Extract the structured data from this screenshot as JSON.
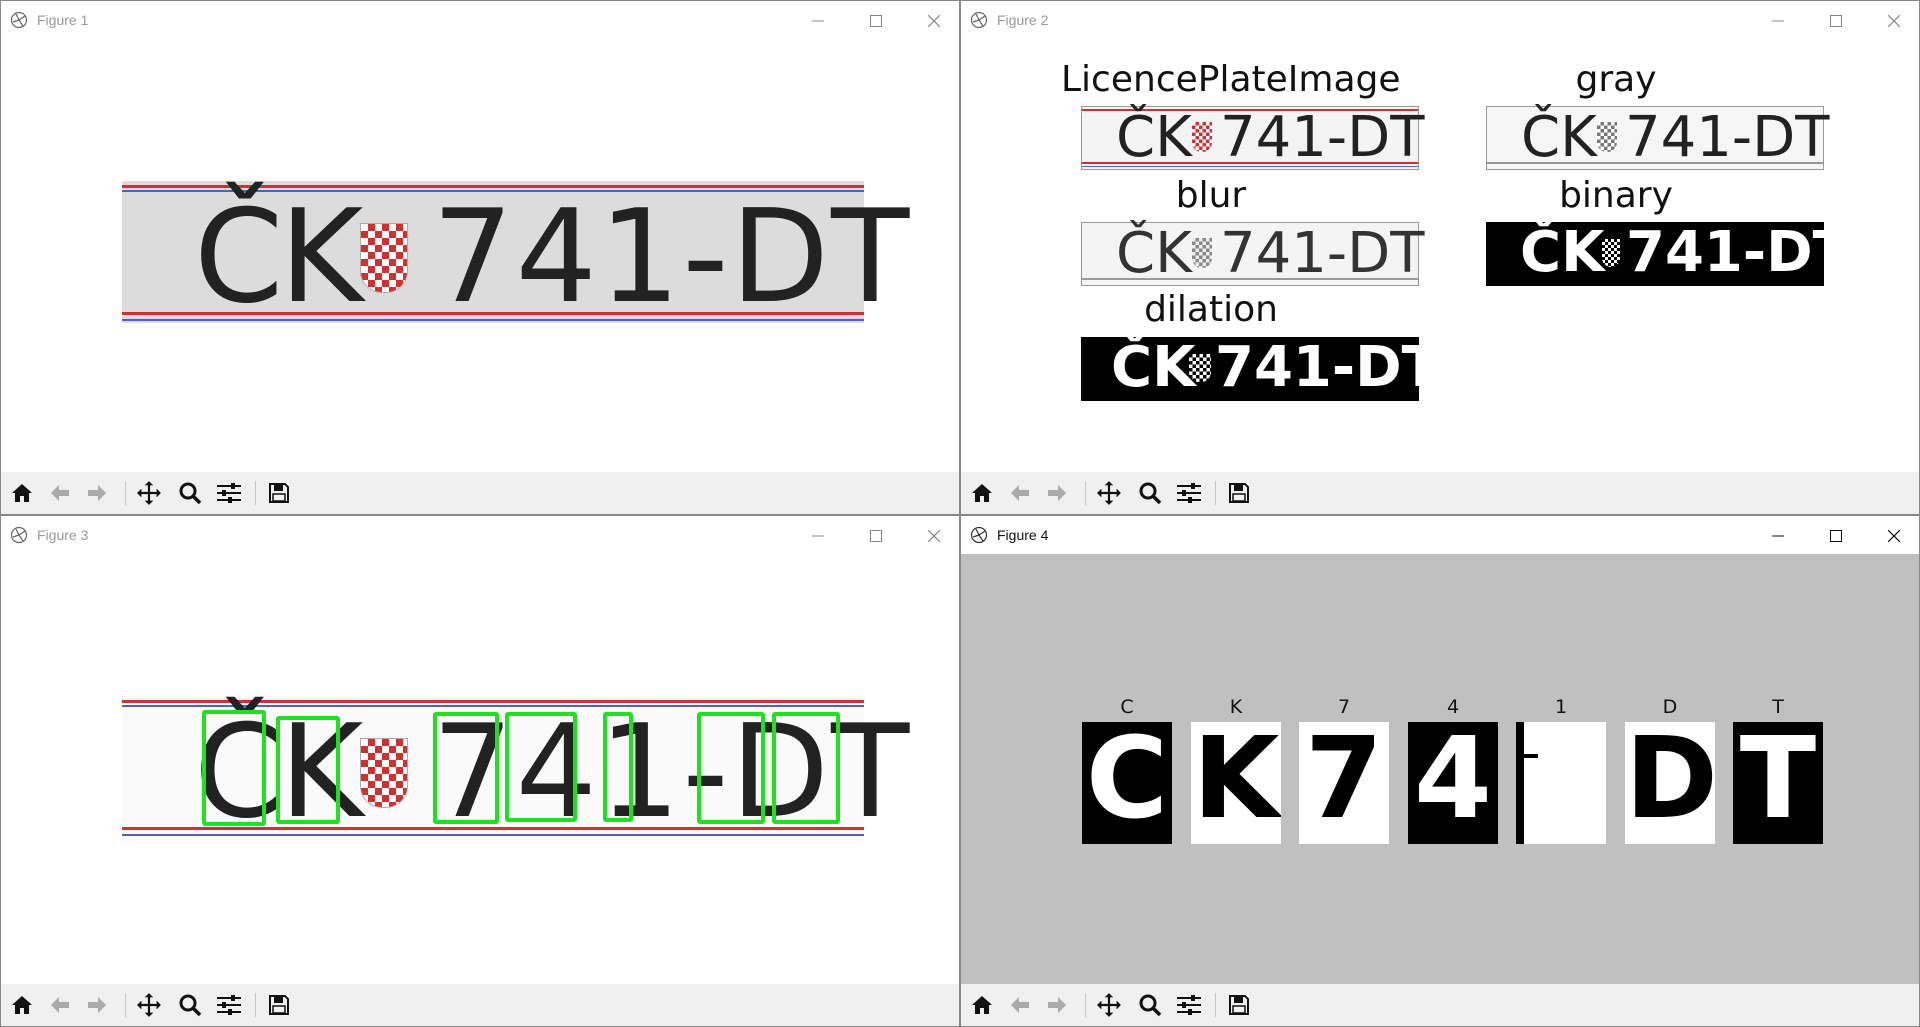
{
  "figures": [
    {
      "title": "Figure 1"
    },
    {
      "title": "Figure 2"
    },
    {
      "title": "Figure 3"
    },
    {
      "title": "Figure 4"
    }
  ],
  "plate_text": {
    "left": "ČK",
    "right": "741-DT"
  },
  "figure2": {
    "panels": [
      "LicencePlateImage",
      "gray",
      "blur",
      "binary",
      "dilation"
    ]
  },
  "figure4": {
    "labels": [
      "C",
      "K",
      "7",
      "4",
      "1",
      "D",
      "T"
    ],
    "background": "#c0c0c0"
  },
  "colors": {
    "bbox": "#21e021",
    "plate_red": "#d03030",
    "plate_blue": "#5060c0"
  },
  "toolbar_icons": [
    "home-icon",
    "back-arrow-icon",
    "forward-arrow-icon",
    "pan-icon",
    "zoom-icon",
    "configure-subplots-icon",
    "save-icon"
  ]
}
